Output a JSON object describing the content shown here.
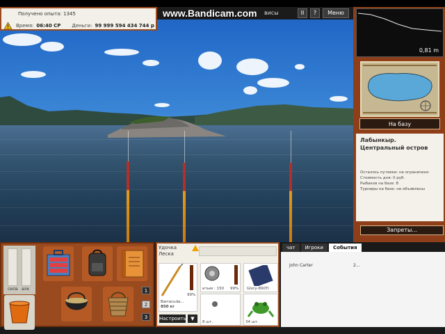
{
  "info": {
    "experience_text": "Получено опыта: 1345",
    "time_label": "Время:",
    "time_value": "06:40 СР",
    "money_label": "Деньги:",
    "money_value": "99 999 594 434 744 р"
  },
  "topbar": {
    "watermark": "www.Bandicam.com",
    "services_label": "висы",
    "pause_label": "II",
    "help_label": "?",
    "menu_label": "Меню"
  },
  "right_panel": {
    "depth_value": "0,81 m",
    "to_base_label": "На базу",
    "location_name": "Лабынкыр. Центральный остров",
    "details": [
      "Осталось путевки: не ограничено",
      "Стоимость дня: 0 руб.",
      "Рыбаков на базе: 8",
      "",
      "Турниры на базе: не объявлены"
    ],
    "bans_label": "Запреты..."
  },
  "inventory": {
    "meter1_label": "сила",
    "meter2_label": "алк",
    "slot_numbers": [
      "1",
      "2",
      "3"
    ]
  },
  "tackle": {
    "rod_label": "Удочка",
    "line_label": "Леска",
    "rod_name": "Barracuda...",
    "rod_weight": "850 кг",
    "percent1": "99%",
    "reel_text": "итым : 150",
    "percent2": "99%",
    "lure_name": "Glory-890Ti",
    "count1": "8 шт.",
    "count2": "34 шт.",
    "setup_label": "Настроить",
    "dropdown_label": "▼"
  },
  "chat": {
    "tabs": [
      "чат",
      "Игроки",
      "События"
    ],
    "player_name": "John Carter",
    "player_value": "2..."
  },
  "colors": {
    "wood": "#9a4a1f",
    "panel_bg": "#f2f0e8",
    "sky": "#3b86d6",
    "water": "#2a4a68"
  }
}
